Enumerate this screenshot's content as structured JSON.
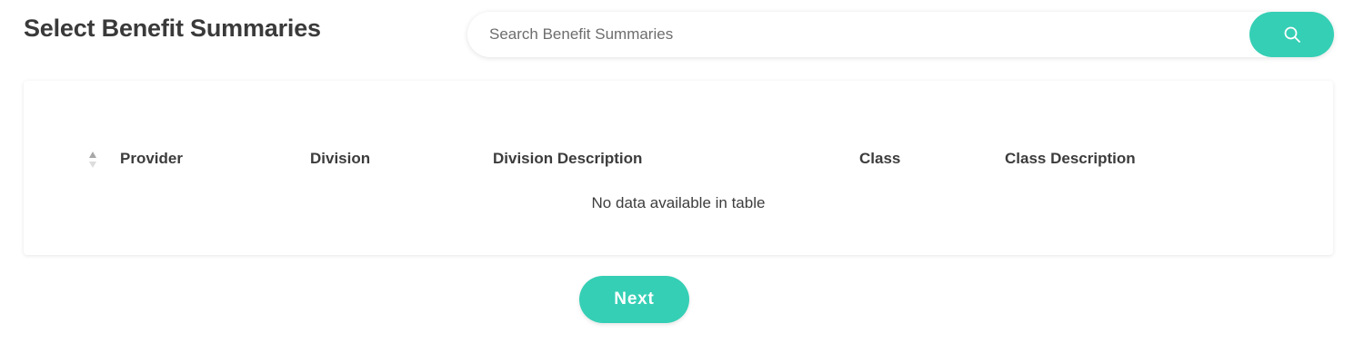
{
  "header": {
    "title": "Select Benefit Summaries"
  },
  "search": {
    "placeholder": "Search Benefit Summaries",
    "value": "",
    "button_icon": "search-icon"
  },
  "table": {
    "columns": [
      {
        "label": "Provider",
        "sortable": true
      },
      {
        "label": "Division"
      },
      {
        "label": "Division Description"
      },
      {
        "label": "Class"
      },
      {
        "label": "Class Description"
      }
    ],
    "rows": [],
    "empty_message": "No data available in table"
  },
  "actions": {
    "next_label": "Next"
  },
  "colors": {
    "accent": "#35cfb5",
    "text": "#3a3a3a",
    "sort_icon": "#a7a7a7"
  }
}
